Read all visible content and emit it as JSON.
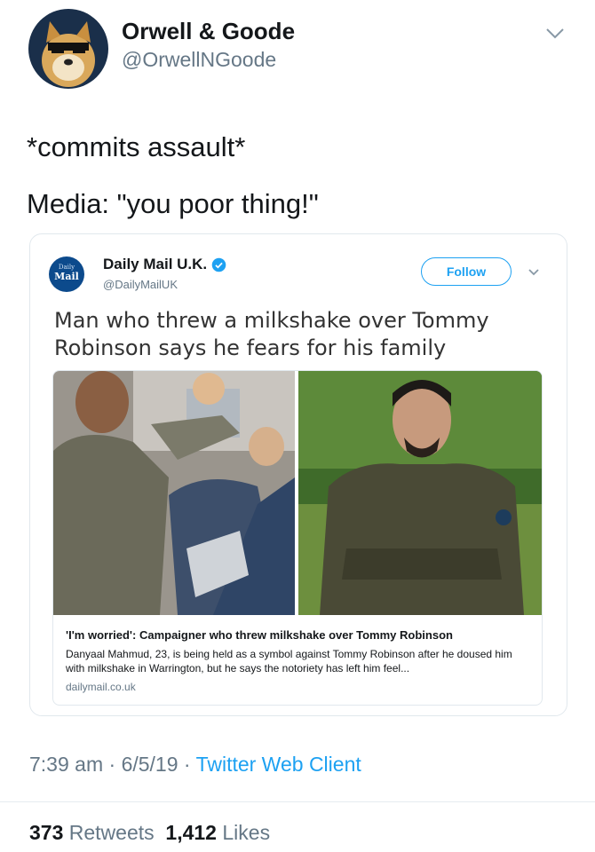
{
  "tweet": {
    "display_name": "Orwell & Goode",
    "handle": "@OrwellNGoode",
    "avatar_icon": "doge-sunglasses-avatar",
    "text_lines": [
      "*commits assault*",
      "Media: \"you poor thing!\""
    ],
    "time": "7:39 am",
    "date": "6/5/19",
    "client": "Twitter Web Client",
    "retweets_count": "373",
    "retweets_label": "Retweets",
    "likes_count": "1,412",
    "likes_label": "Likes",
    "dot": "·"
  },
  "quoted_tweet": {
    "display_name": "Daily Mail U.K.",
    "handle": "@DailyMailUK",
    "verified_icon": "verified-badge-icon",
    "follow_label": "Follow",
    "avatar_text": "Mail",
    "text": "Man who threw a milkshake over Tommy Robinson says he fears for his family",
    "link_card": {
      "title": "'I'm worried': Campaigner who threw milkshake over Tommy Robinson",
      "description": "Danyaal Mahmud, 23, is being held as a symbol against Tommy Robinson after he doused him with milkshake in Warrington, but he says the notoriety has left him feel...",
      "domain": "dailymail.co.uk"
    }
  },
  "colors": {
    "accent": "#1da1f2",
    "secondary_text": "#657786",
    "primary_text": "#14171a",
    "border": "#e1e8ed",
    "avatar_bg": "#1a2f4a"
  }
}
